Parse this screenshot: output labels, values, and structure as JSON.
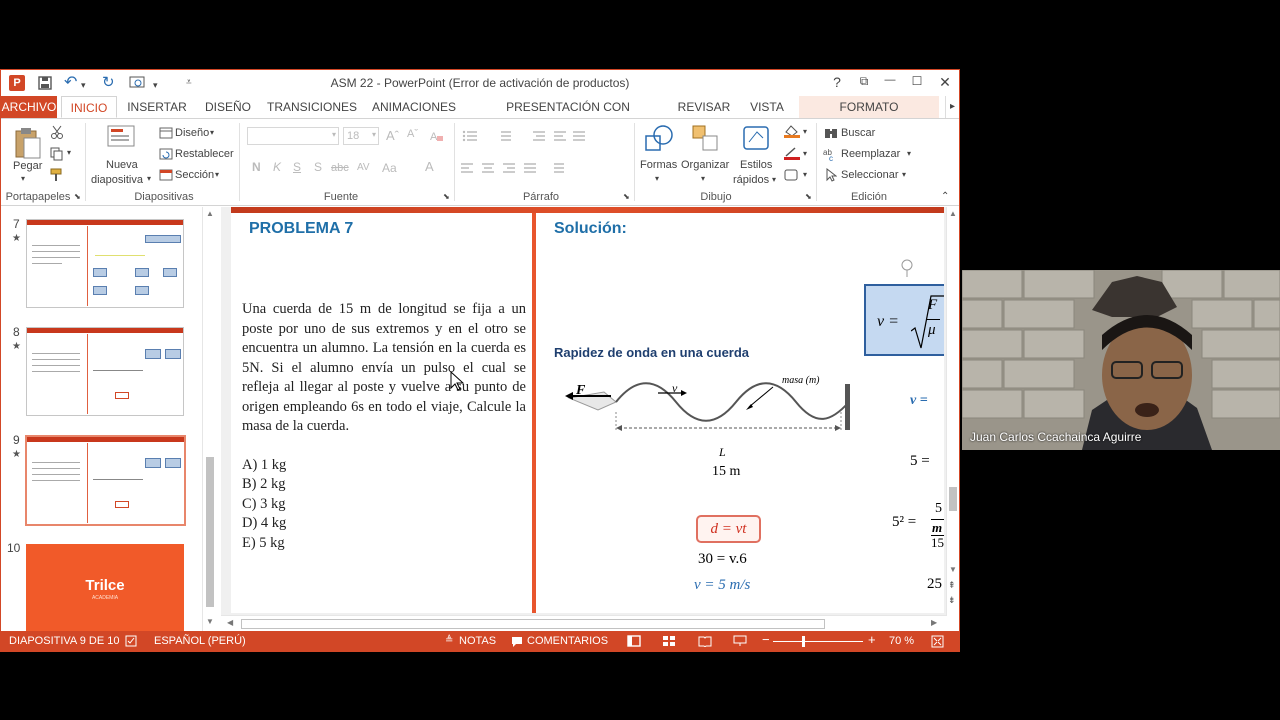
{
  "window": {
    "title": "ASM 22 - PowerPoint (Error de activación de productos)",
    "help": "?",
    "ribbon_display": "⧉",
    "minimize": "—",
    "maximize": "☐",
    "close": "✕"
  },
  "qat": {
    "app_icon": "P",
    "save": "save-icon",
    "undo": "↶",
    "undo_drop": "▾",
    "redo": "↻",
    "touch": "touch-icon",
    "touch_drop": "▾",
    "customize": "⩡"
  },
  "tabs": {
    "file": "ARCHIVO",
    "items": [
      "INICIO",
      "INSERTAR",
      "DISEÑO",
      "TRANSICIONES",
      "ANIMACIONES",
      "PRESENTACIÓN CON DIAPOSITIVAS",
      "REVISAR",
      "VISTA"
    ],
    "context": "FORMATO",
    "scroll": "▸"
  },
  "ribbon": {
    "portapapeles": {
      "pegar": "Pegar",
      "label": "Portapapeles"
    },
    "diapositivas": {
      "nueva1": "Nueva",
      "nueva2": "diapositiva",
      "diseno": "Diseño",
      "restablecer": "Restablecer",
      "seccion": "Sección",
      "label": "Diapositivas"
    },
    "fuente": {
      "size": "18",
      "n": "N",
      "k": "K",
      "s": "S",
      "s2": "S",
      "abc": "abc",
      "av": "AV",
      "aa": "Aa",
      "a": "A",
      "label": "Fuente"
    },
    "parrafo": {
      "label": "Párrafo"
    },
    "dibujo": {
      "formas": "Formas",
      "organizar": "Organizar",
      "estilos1": "Estilos",
      "estilos2": "rápidos",
      "label": "Dibujo"
    },
    "edicion": {
      "buscar": "Buscar",
      "reemplazar": "Reemplazar",
      "seleccionar": "Seleccionar",
      "label": "Edición"
    },
    "collapse": "⌃"
  },
  "thumbnails": [
    {
      "num": "7",
      "star": "★"
    },
    {
      "num": "8",
      "star": "★"
    },
    {
      "num": "9",
      "star": "★"
    },
    {
      "num": "10",
      "logo": "Trilce",
      "sub": "ACADEMIA"
    }
  ],
  "slide": {
    "problem_title": "PROBLEMA 7",
    "problem_text": "Una cuerda de 15 m de longitud se fija a un poste por uno de sus extremos y en el otro se encuentra un alumno. La tensión en la cuerda es 5N. Si el alumno envía un pulso el cual se refleja al llegar al poste y vuelve a su punto de origen empleando 6s en todo el viaje, Calcule la masa de la cuerda.",
    "options": [
      "A) 1 kg",
      "B) 2 kg",
      "C) 3 kg",
      "D) 4 kg",
      "E) 5 kg"
    ],
    "solution_title": "Solución:",
    "subtitle": "Rapidez de onda en una cuerda",
    "diagram": {
      "f": "F",
      "v": "v",
      "masa": "masa (m)",
      "l": "L",
      "len": "15 m"
    },
    "formula": {
      "v": "v =",
      "num": "F",
      "den": "μ"
    },
    "eq_d": "d = vt",
    "eq_30": "30 = v.6",
    "eq_v": "v = 5 m/s",
    "right_v": "v =",
    "right_5": "5 =",
    "right_52": "5² =",
    "right_frac_num": "5",
    "right_frac_m": "m",
    "right_frac_15": "15",
    "right_25": "25"
  },
  "status": {
    "slide": "DIAPOSITIVA 9 DE 10",
    "lang": "ESPAÑOL (PERÚ)",
    "notes": "NOTAS",
    "comments": "COMENTARIOS",
    "zoom": "70 %"
  },
  "webcam": {
    "name": "Juan Carlos Ccachainca Aguirre"
  }
}
